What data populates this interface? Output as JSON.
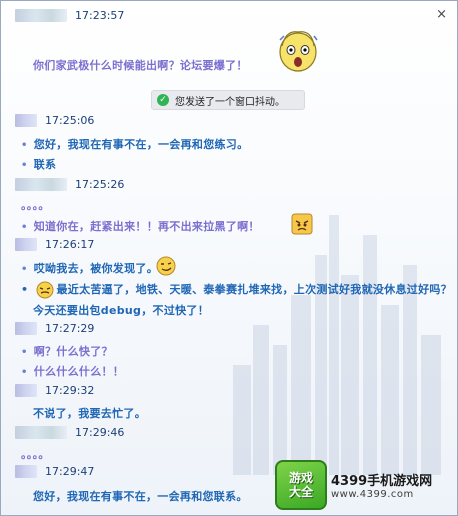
{
  "window": {
    "close_glyph": "×"
  },
  "messages": [
    {
      "time": "17:23:57",
      "lines": [
        "你们家武极什么时候能出啊？论坛要爆了！"
      ]
    },
    {
      "time": "17:25:06",
      "lines": [
        "您好，我现在有事不在，一会再和您练习。",
        "联系"
      ]
    },
    {
      "time": "17:25:26",
      "lines": [
        "。。。。",
        "知道你在，赶紧出来！！再不出来拉黑了啊！"
      ]
    },
    {
      "time": "17:26:17",
      "lines": [
        "哎呦我去，被你发现了。",
        "最近太苦逼了，地铁、天暖、泰拳赛扎堆来找，上次测试好我就没休息过好吗？",
        "今天还要出包debug，不过快了！"
      ]
    },
    {
      "time": "17:27:29",
      "lines": [
        "啊？什么快了？",
        "什么什么什么！！"
      ]
    },
    {
      "time": "17:29:32",
      "lines": [
        "不说了，我要去忙了。"
      ]
    },
    {
      "time": "17:29:46",
      "lines": [
        "。。。。"
      ]
    },
    {
      "time": "17:29:47",
      "lines": [
        "您好，我现在有事不在，一会再和您联系。"
      ]
    }
  ],
  "notice": {
    "text": "您发送了一个窗口抖动。",
    "icon": "check-icon"
  },
  "watermark": {
    "badge_line1": "游戏",
    "badge_line2": "大全",
    "brand": "4399手机游戏网",
    "url": "www.4399.com"
  },
  "colors": {
    "self_text": "#7b6fd0",
    "other_text": "#1f66b5",
    "time": "#1c3f78",
    "notice_bg": "#e9eaee",
    "logo_green": "#3aa824"
  }
}
